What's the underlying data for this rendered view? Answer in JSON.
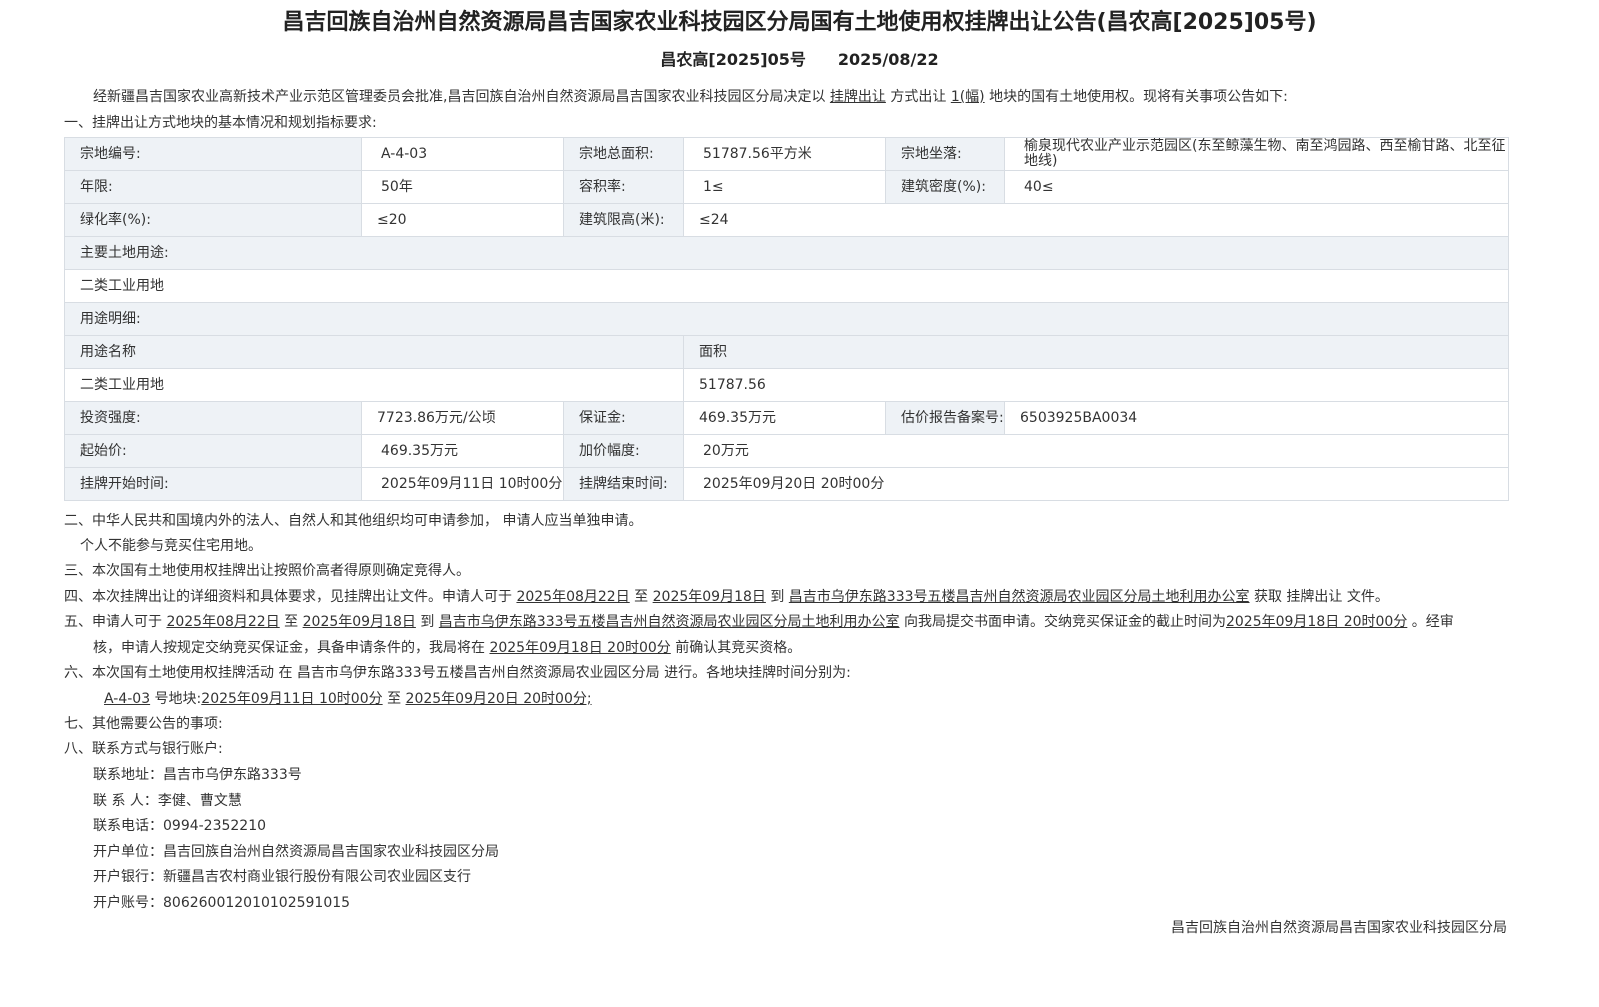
{
  "title": "昌吉回族自治州自然资源局昌吉国家农业科技园区分局国有土地使用权挂牌出让公告(昌农高[2025]05号)",
  "doc_number": "昌农高[2025]05号",
  "doc_date": "2025/08/22",
  "intro": {
    "t1": "经新疆昌吉国家农业高新技术产业示范区管理委员会批准,昌吉回族自治州自然资源局昌吉国家农业科技园区分局决定以 ",
    "method": "挂牌出让",
    "t2": " 方式出让 ",
    "count": "1(幅)",
    "t3": " 地块的国有土地使用权。现将有关事项公告如下:"
  },
  "section1_heading": "一、挂牌出让方式地块的基本情况和规划指标要求:",
  "table": {
    "parcel_no_label": "宗地编号:",
    "parcel_no": "A-4-03",
    "total_area_label": "宗地总面积:",
    "total_area": "51787.56平方米",
    "location_label": "宗地坐落:",
    "location": "榆泉现代农业产业示范园区(东至鲸藻生物、南至鸿园路、西至榆甘路、北至征地线)",
    "term_label": "年限:",
    "term": "50年",
    "far_label": "容积率:",
    "far": "1≤",
    "density_label": "建筑密度(%):",
    "density": "40≤",
    "green_label": "绿化率(%):",
    "green": "≤20",
    "height_label": "建筑限高(米):",
    "height": "≤24",
    "main_use_label": "主要土地用途:",
    "main_use": "二类工业用地",
    "use_detail_label": "用途明细:",
    "use_name_header": "用途名称",
    "area_header": "面积",
    "use_name": "二类工业用地",
    "use_area": "51787.56",
    "invest_label": "投资强度:",
    "invest": "7723.86万元/公顷",
    "deposit_label": "保证金:",
    "deposit": "469.35万元",
    "appraisal_label": "估价报告备案号:",
    "appraisal": "6503925BA0034",
    "start_price_label": "起始价:",
    "start_price": "469.35万元",
    "increment_label": "加价幅度:",
    "increment": "20万元",
    "listing_start_label": "挂牌开始时间:",
    "listing_start": "2025年09月11日 10时00分",
    "listing_end_label": "挂牌结束时间:",
    "listing_end": "2025年09月20日 20时00分"
  },
  "s2": {
    "line1": "二、中华人民共和国境内外的法人、自然人和其他组织均可申请参加， 申请人应当单独申请。",
    "line2": "个人不能参与竞买住宅用地。"
  },
  "s3": "三、本次国有土地使用权挂牌出让按照价高者得原则确定竞得人。",
  "s4": {
    "t1": "四、本次挂牌出让的详细资料和具体要求，见挂牌出让文件。申请人可于 ",
    "d1": "2025年08月22日",
    "t2": " 至 ",
    "d2": "2025年09月18日",
    "t3": " 到 ",
    "place": "昌吉市乌伊东路333号五楼昌吉州自然资源局农业园区分局土地利用办公室",
    "t4": " 获取 挂牌出让 文件。"
  },
  "s5": {
    "t1": "五、申请人可于 ",
    "d1": "2025年08月22日",
    "t2": " 至 ",
    "d2": "2025年09月18日",
    "t3": " 到 ",
    "place": "昌吉市乌伊东路333号五楼昌吉州自然资源局农业园区分局土地利用办公室",
    "t4": " 向我局提交书面申请。交纳竞买保证金的截止时间为",
    "deadline": "2025年09月18日 20时00分",
    "t5": " 。经审",
    "t6": "核，申请人按规定交纳竞买保证金，具备申请条件的，我局将在 ",
    "confirm": "2025年09月18日 20时00分",
    "t7": " 前确认其竞买资格。"
  },
  "s6": {
    "t1": "六、本次国有土地使用权挂牌活动 在 昌吉市乌伊东路333号五楼昌吉州自然资源局农业园区分局 进行。各地块挂牌时间分别为:",
    "parcel": "A-4-03",
    "t2": " 号地块:",
    "start": "2025年09月11日 10时00分",
    "t3": " 至 ",
    "end": "2025年09月20日 20时00分;"
  },
  "s7": "七、其他需要公告的事项:",
  "s8": "八、联系方式与银行账户:",
  "contacts": [
    "联系地址：昌吉市乌伊东路333号",
    "联 系 人：李健、曹文慧",
    "联系电话：0994-2352210",
    "开户单位：昌吉回族自治州自然资源局昌吉国家农业科技园区分局",
    "开户银行：新疆昌吉农村商业银行股份有限公司农业园区支行",
    "开户账号：806260012010102591015"
  ],
  "footer": "昌吉回族自治州自然资源局昌吉国家农业科技园区分局"
}
